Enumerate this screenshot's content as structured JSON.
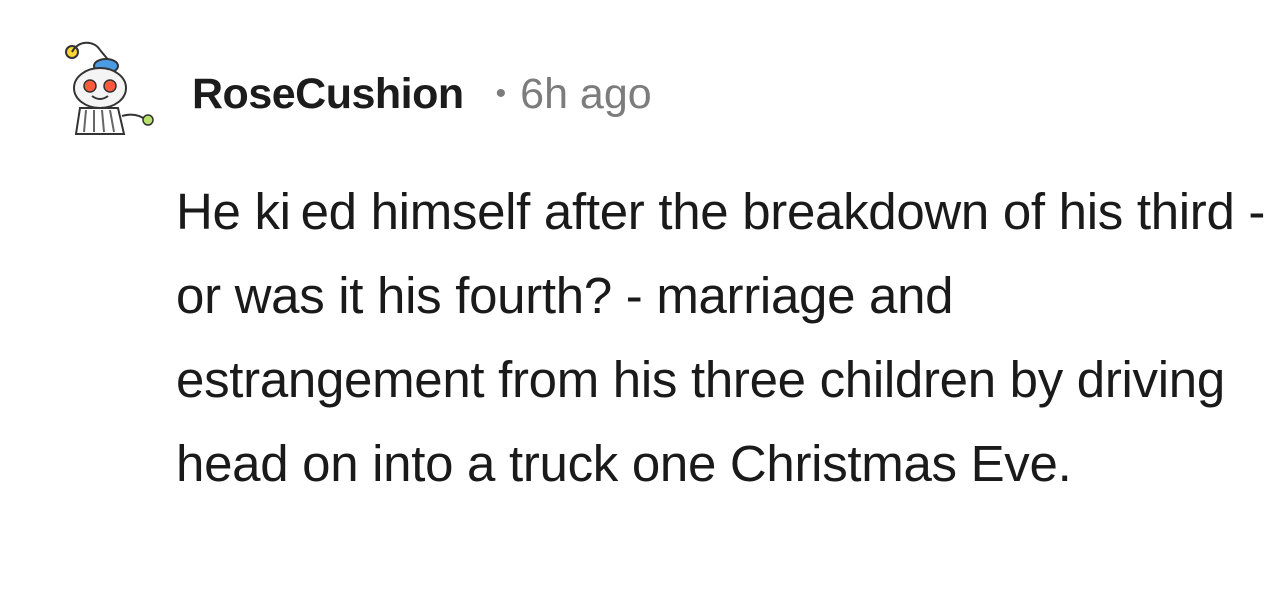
{
  "comment": {
    "username": "RoseCushion",
    "separator": "•",
    "timestamp": "6h ago",
    "avatar_icon": "snoo-avatar-icon",
    "body": "He ki ed himself after the breakdown of his third - or was it his fourth? - marriage and estrangement from his three children by driving head on into a truck one Christmas Eve."
  },
  "colors": {
    "username": "#1c1c1c",
    "meta": "#7c7c7c",
    "body": "#1a1a1a",
    "background": "#ffffff"
  }
}
